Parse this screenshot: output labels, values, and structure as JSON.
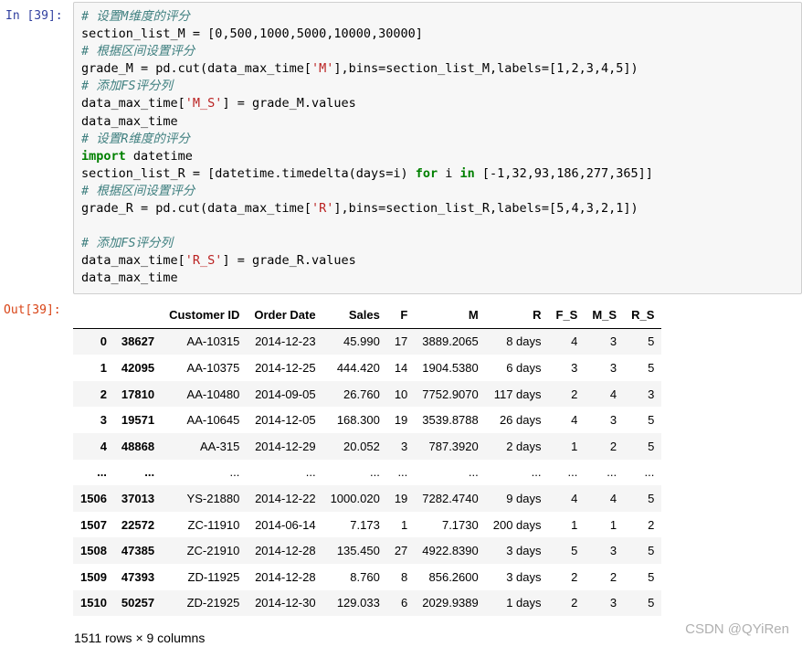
{
  "input_prompt": "In  [39]:",
  "output_prompt": "Out[39]:",
  "code_lines": [
    [
      {
        "t": "# 设置M维度的评分",
        "c": "cm"
      }
    ],
    [
      {
        "t": "section_list_M = [0,500,1000,5000,10000,30000]",
        "c": ""
      }
    ],
    [
      {
        "t": "# 根据区间设置评分",
        "c": "cm"
      }
    ],
    [
      {
        "t": "grade_M = pd.cut(data_max_time[",
        "c": ""
      },
      {
        "t": "'M'",
        "c": "st"
      },
      {
        "t": "],bins=section_list_M,labels=[1,2,3,4,5])",
        "c": ""
      }
    ],
    [
      {
        "t": "# 添加FS评分列",
        "c": "cm"
      }
    ],
    [
      {
        "t": "data_max_time[",
        "c": ""
      },
      {
        "t": "'M_S'",
        "c": "st"
      },
      {
        "t": "] = grade_M.values",
        "c": ""
      }
    ],
    [
      {
        "t": "data_max_time",
        "c": ""
      }
    ],
    [
      {
        "t": "# 设置R维度的评分",
        "c": "cm"
      }
    ],
    [
      {
        "t": "import",
        "c": "kw"
      },
      {
        "t": " datetime",
        "c": ""
      }
    ],
    [
      {
        "t": "section_list_R = [datetime.timedelta(days=i) ",
        "c": ""
      },
      {
        "t": "for",
        "c": "kw"
      },
      {
        "t": " i ",
        "c": ""
      },
      {
        "t": "in",
        "c": "kw"
      },
      {
        "t": " [-1,32,93,186,277,365]]",
        "c": ""
      }
    ],
    [
      {
        "t": "# 根据区间设置评分",
        "c": "cm"
      }
    ],
    [
      {
        "t": "grade_R = pd.cut(data_max_time[",
        "c": ""
      },
      {
        "t": "'R'",
        "c": "st"
      },
      {
        "t": "],bins=section_list_R,labels=[5,4,3,2,1])",
        "c": ""
      }
    ],
    [
      {
        "t": "",
        "c": ""
      }
    ],
    [
      {
        "t": "# 添加FS评分列",
        "c": "cm"
      }
    ],
    [
      {
        "t": "data_max_time[",
        "c": ""
      },
      {
        "t": "'R_S'",
        "c": "st"
      },
      {
        "t": "] = grade_R.values",
        "c": ""
      }
    ],
    [
      {
        "t": "data_max_time",
        "c": ""
      }
    ]
  ],
  "table": {
    "columns": [
      "",
      "",
      "Customer ID",
      "Order Date",
      "Sales",
      "F",
      "M",
      "R",
      "F_S",
      "M_S",
      "R_S"
    ],
    "rows": [
      [
        "0",
        "38627",
        "AA-10315",
        "2014-12-23",
        "45.990",
        "17",
        "3889.2065",
        "8 days",
        "4",
        "3",
        "5"
      ],
      [
        "1",
        "42095",
        "AA-10375",
        "2014-12-25",
        "444.420",
        "14",
        "1904.5380",
        "6 days",
        "3",
        "3",
        "5"
      ],
      [
        "2",
        "17810",
        "AA-10480",
        "2014-09-05",
        "26.760",
        "10",
        "7752.9070",
        "117 days",
        "2",
        "4",
        "3"
      ],
      [
        "3",
        "19571",
        "AA-10645",
        "2014-12-05",
        "168.300",
        "19",
        "3539.8788",
        "26 days",
        "4",
        "3",
        "5"
      ],
      [
        "4",
        "48868",
        "AA-315",
        "2014-12-29",
        "20.052",
        "3",
        "787.3920",
        "2 days",
        "1",
        "2",
        "5"
      ],
      [
        "...",
        "...",
        "...",
        "...",
        "...",
        "...",
        "...",
        "...",
        "...",
        "...",
        "..."
      ],
      [
        "1506",
        "37013",
        "YS-21880",
        "2014-12-22",
        "1000.020",
        "19",
        "7282.4740",
        "9 days",
        "4",
        "4",
        "5"
      ],
      [
        "1507",
        "22572",
        "ZC-11910",
        "2014-06-14",
        "7.173",
        "1",
        "7.1730",
        "200 days",
        "1",
        "1",
        "2"
      ],
      [
        "1508",
        "47385",
        "ZC-21910",
        "2014-12-28",
        "135.450",
        "27",
        "4922.8390",
        "3 days",
        "5",
        "3",
        "5"
      ],
      [
        "1509",
        "47393",
        "ZD-11925",
        "2014-12-28",
        "8.760",
        "8",
        "856.2600",
        "3 days",
        "2",
        "2",
        "5"
      ],
      [
        "1510",
        "50257",
        "ZD-21925",
        "2014-12-30",
        "129.033",
        "6",
        "2029.9389",
        "1 days",
        "2",
        "3",
        "5"
      ]
    ]
  },
  "shape_text": "1511 rows × 9 columns",
  "watermark": "CSDN @QYiRen"
}
